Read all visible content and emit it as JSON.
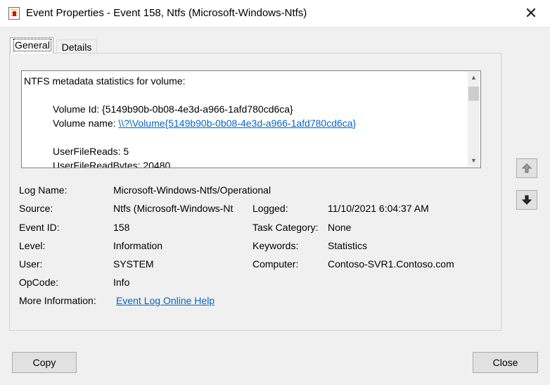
{
  "window": {
    "title": "Event Properties - Event 158, Ntfs (Microsoft-Windows-Ntfs)",
    "close_glyph": "✕"
  },
  "tabs": [
    "General",
    "Details"
  ],
  "description": {
    "heading": "NTFS metadata statistics for volume:",
    "volume_id": "Volume Id: {5149b90b-0b08-4e3d-a966-1afd780cd6ca}",
    "volume_name_label": "Volume name: ",
    "volume_name_link": "\\\\?\\Volume{5149b90b-0b08-4e3d-a966-1afd780cd6ca}",
    "user_file_reads": "UserFileReads: 5",
    "user_file_read_bytes": "UserFileReadBytes: 20480"
  },
  "fields": {
    "log_name": {
      "label": "Log Name:",
      "value": "Microsoft-Windows-Ntfs/Operational"
    },
    "source": {
      "label": "Source:",
      "value": "Ntfs (Microsoft-Windows-Nt"
    },
    "logged": {
      "label": "Logged:",
      "value": "11/10/2021 6:04:37 AM"
    },
    "event_id": {
      "label": "Event ID:",
      "value": "158"
    },
    "task_category": {
      "label": "Task Category:",
      "value": "None"
    },
    "level": {
      "label": "Level:",
      "value": "Information"
    },
    "keywords": {
      "label": "Keywords:",
      "value": "Statistics"
    },
    "user": {
      "label": "User:",
      "value": "SYSTEM"
    },
    "computer": {
      "label": "Computer:",
      "value": "Contoso-SVR1.Contoso.com"
    },
    "opcode": {
      "label": "OpCode:",
      "value": "Info"
    },
    "more_info": {
      "label": "More Information:",
      "link": "Event Log Online Help"
    }
  },
  "buttons": {
    "copy": "Copy",
    "close": "Close"
  },
  "icons": {
    "app": "event-viewer-icon",
    "up": "up-arrow-icon",
    "down": "down-arrow-icon"
  }
}
